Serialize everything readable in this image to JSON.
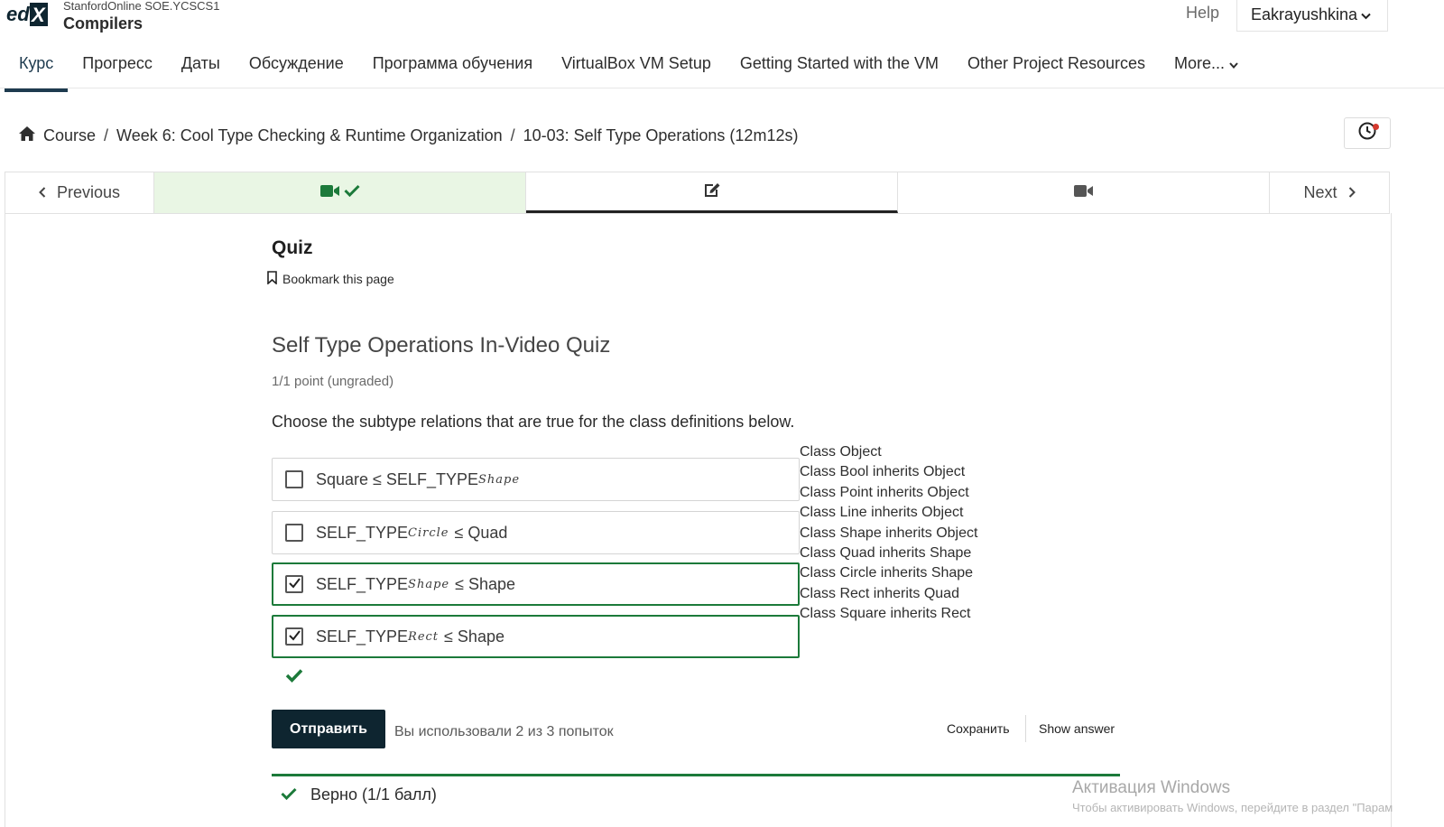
{
  "header": {
    "logo_text": "edX",
    "org": "StanfordOnline SOE.YCSCS1",
    "course_title": "Compilers",
    "help_label": "Help",
    "username": "Eakrayushkina"
  },
  "course_tabs": [
    {
      "label": "Курс",
      "active": true
    },
    {
      "label": "Прогресс"
    },
    {
      "label": "Даты"
    },
    {
      "label": "Обсуждение"
    },
    {
      "label": "Программа обучения"
    },
    {
      "label": "VirtualBox VM Setup"
    },
    {
      "label": "Getting Started with the VM"
    },
    {
      "label": "Other Project Resources"
    },
    {
      "label": "More..."
    }
  ],
  "breadcrumb": {
    "items": [
      "Course",
      "Week 6: Cool Type Checking & Runtime Organization",
      "10-03: Self Type Operations (12m12s)"
    ],
    "separator": "/"
  },
  "sequence": {
    "previous_label": "Previous",
    "next_label": "Next",
    "units": [
      {
        "icon": "video-icon",
        "complete": true
      },
      {
        "icon": "edit-icon",
        "active": true
      },
      {
        "icon": "video-icon"
      }
    ]
  },
  "quiz": {
    "heading": "Quiz",
    "bookmark_label": "Bookmark this page",
    "problem_title": "Self Type Operations In-Video Quiz",
    "points": "1/1 point (ungraded)",
    "question": "Choose the subtype relations that are true for the class definitions below.",
    "options": [
      {
        "before": "Square ≤ SELF_TYPE",
        "subscript": "Shape",
        "after": "",
        "checked": false
      },
      {
        "before": "SELF_TYPE",
        "subscript": "Circle",
        "after": "≤ Quad",
        "checked": false
      },
      {
        "before": "SELF_TYPE",
        "subscript": "Shape",
        "after": "≤ Shape",
        "checked": true
      },
      {
        "before": "SELF_TYPE",
        "subscript": "Rect",
        "after": "≤ Shape",
        "checked": true
      }
    ],
    "class_definitions": [
      "Class Object",
      "Class Bool inherits Object",
      "Class Point inherits Object",
      "Class Line inherits Object",
      "Class Shape inherits Object",
      "Class Quad inherits Shape",
      "Class Circle inherits Shape",
      "Class Rect inherits Quad",
      "Class Square inherits Rect"
    ],
    "submit_label": "Отправить",
    "attempts_text": "Вы использовали 2 из 3 попыток",
    "save_label": "Сохранить",
    "show_answer_label": "Show answer",
    "result_text": "Верно (1/1 балл)"
  },
  "overlay": {
    "watermark_title": "Активация Windows",
    "watermark_sub": "Чтобы активировать Windows, перейдите в раздел \"Парам"
  },
  "colors": {
    "brand_dark": "#0e2530",
    "success_green": "#1c7a3a",
    "complete_bg": "#e9f6e4"
  }
}
